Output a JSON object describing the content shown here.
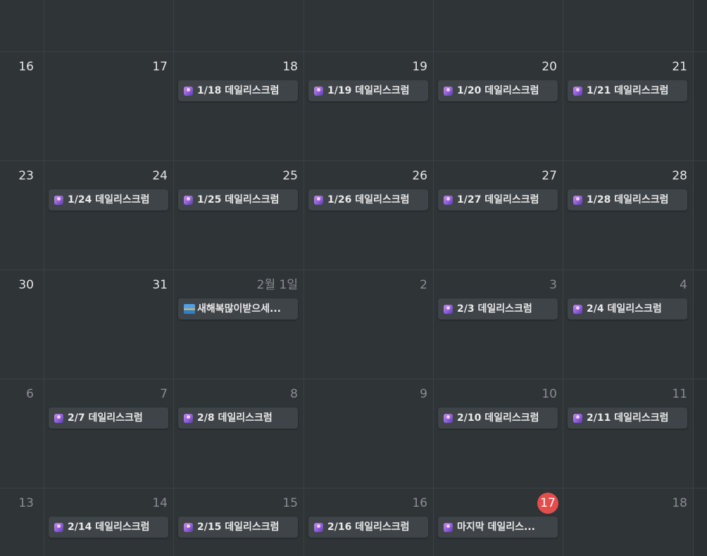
{
  "week_labels": [
    "16",
    "23",
    "30",
    "6",
    "13"
  ],
  "weeks": [
    {
      "days": [
        {
          "num": "17",
          "style": "cur"
        },
        {
          "num": "18",
          "style": "cur",
          "event": "1/18 데일리스크럼"
        },
        {
          "num": "19",
          "style": "cur",
          "event": "1/19 데일리스크럼"
        },
        {
          "num": "20",
          "style": "cur",
          "event": "1/20 데일리스크럼"
        },
        {
          "num": "21",
          "style": "cur",
          "event": "1/21 데일리스크럼"
        }
      ]
    },
    {
      "days": [
        {
          "num": "24",
          "style": "cur",
          "event": "1/24 데일리스크럼"
        },
        {
          "num": "25",
          "style": "cur",
          "event": "1/25 데일리스크럼"
        },
        {
          "num": "26",
          "style": "cur",
          "event": "1/26 데일리스크럼"
        },
        {
          "num": "27",
          "style": "cur",
          "event": "1/27 데일리스크럼"
        },
        {
          "num": "28",
          "style": "cur",
          "event": "1/28 데일리스크럼"
        }
      ]
    },
    {
      "days": [
        {
          "num": "31",
          "style": "cur"
        },
        {
          "num": "2월 1일",
          "style": "dim",
          "event": "새해복많이받으세...",
          "icon": "sunrise-icon"
        },
        {
          "num": "2",
          "style": "dim"
        },
        {
          "num": "3",
          "style": "dim",
          "event": "2/3 데일리스크럼"
        },
        {
          "num": "4",
          "style": "dim",
          "event": "2/4 데일리스크럼"
        }
      ]
    },
    {
      "days": [
        {
          "num": "7",
          "style": "dim",
          "event": "2/7 데일리스크럼"
        },
        {
          "num": "8",
          "style": "dim",
          "event": "2/8 데일리스크럼"
        },
        {
          "num": "9",
          "style": "dim"
        },
        {
          "num": "10",
          "style": "dim",
          "event": "2/10 데일리스크럼"
        },
        {
          "num": "11",
          "style": "dim",
          "event": "2/11 데일리스크럼"
        }
      ]
    },
    {
      "days": [
        {
          "num": "14",
          "style": "dim",
          "event": "2/14 데일리스크럼"
        },
        {
          "num": "15",
          "style": "dim",
          "event": "2/15 데일리스크럼"
        },
        {
          "num": "16",
          "style": "dim",
          "event": "2/16 데일리스크럼"
        },
        {
          "num": "17",
          "style": "today",
          "event": "마지막 데일리스..."
        },
        {
          "num": "18",
          "style": "dim"
        }
      ]
    }
  ],
  "colors": {
    "background": "#2f3437",
    "grid_line": "#3c4145",
    "event_bg": "#3f4448",
    "today_badge": "#e54d4d",
    "text_current": "#e6e6e6",
    "text_dim": "#8a8e92"
  },
  "event_icon": "person-gradient-icon"
}
